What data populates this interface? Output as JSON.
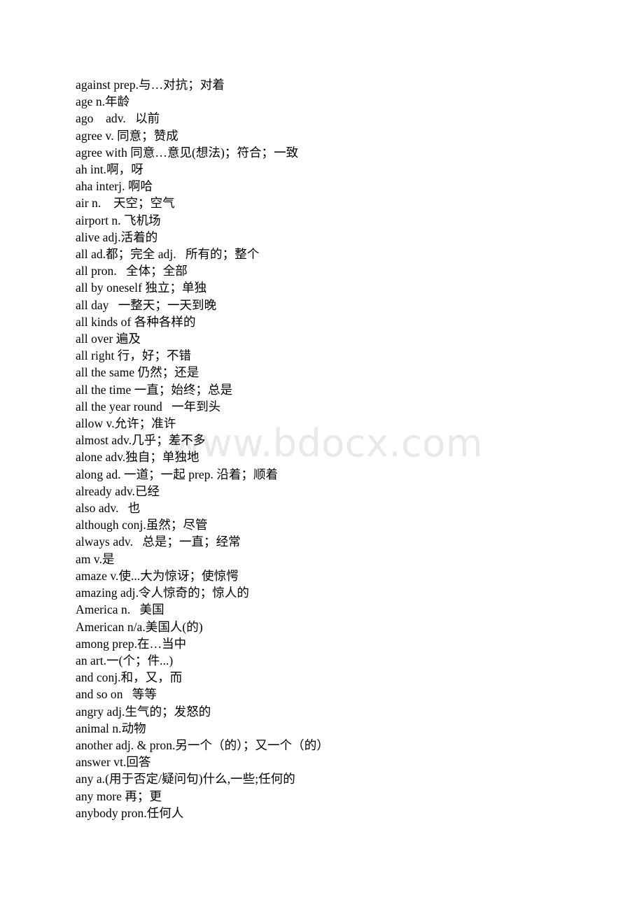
{
  "document": {
    "type": "word-list-page",
    "background_color": "#ffffff",
    "text_color": "#000000"
  },
  "watermark": {
    "text": "www.bdocx.com",
    "color": "#e9e9e9"
  },
  "entries": [
    {
      "line": "against prep.与…对抗；对着"
    },
    {
      "line": "age n.年龄"
    },
    {
      "line": "ago    adv.   以前"
    },
    {
      "line": "agree v. 同意；赞成"
    },
    {
      "line": "agree with 同意…意见(想法)；符合；一致"
    },
    {
      "line": "ah int.啊，呀"
    },
    {
      "line": "aha interj. 啊哈"
    },
    {
      "line": "air n.    天空；空气"
    },
    {
      "line": "airport n. 飞机场"
    },
    {
      "line": "alive adj.活着的"
    },
    {
      "line": "all ad.都；完全 adj.   所有的；整个"
    },
    {
      "line": "all pron.   全体；全部"
    },
    {
      "line": "all by oneself 独立；单独"
    },
    {
      "line": "all day   一整天；一天到晚"
    },
    {
      "line": "all kinds of 各种各样的"
    },
    {
      "line": "all over 遍及"
    },
    {
      "line": "all right 行，好；不错"
    },
    {
      "line": "all the same 仍然；还是"
    },
    {
      "line": "all the time 一直；始终；总是"
    },
    {
      "line": "all the year round   一年到头"
    },
    {
      "line": "allow v.允许；准许"
    },
    {
      "line": "almost adv.几乎；差不多"
    },
    {
      "line": "alone adv.独自；单独地"
    },
    {
      "line": "along ad. 一道；一起 prep. 沿着；顺着"
    },
    {
      "line": "already adv.已经"
    },
    {
      "line": "also adv.   也"
    },
    {
      "line": "although conj.虽然；尽管"
    },
    {
      "line": "always adv.   总是；一直；经常"
    },
    {
      "line": "am v.是"
    },
    {
      "line": "amaze v.使...大为惊讶；使惊愕"
    },
    {
      "line": "amazing adj.令人惊奇的；惊人的"
    },
    {
      "line": "America n.   美国"
    },
    {
      "line": "American n/a.美国人(的)"
    },
    {
      "line": "among prep.在…当中"
    },
    {
      "line": "an art.一(个；件...)"
    },
    {
      "line": "and conj.和，又，而"
    },
    {
      "line": "and so on   等等"
    },
    {
      "line": "angry adj.生气的；发怒的"
    },
    {
      "line": "animal n.动物"
    },
    {
      "line": "another adj. & pron.另一个（的）；又一个（的）"
    },
    {
      "line": "answer vt.回答"
    },
    {
      "line": "any a.(用于否定/疑问句)什么,一些;任何的"
    },
    {
      "line": "any more 再；更"
    },
    {
      "line": "anybody pron.任何人"
    }
  ]
}
